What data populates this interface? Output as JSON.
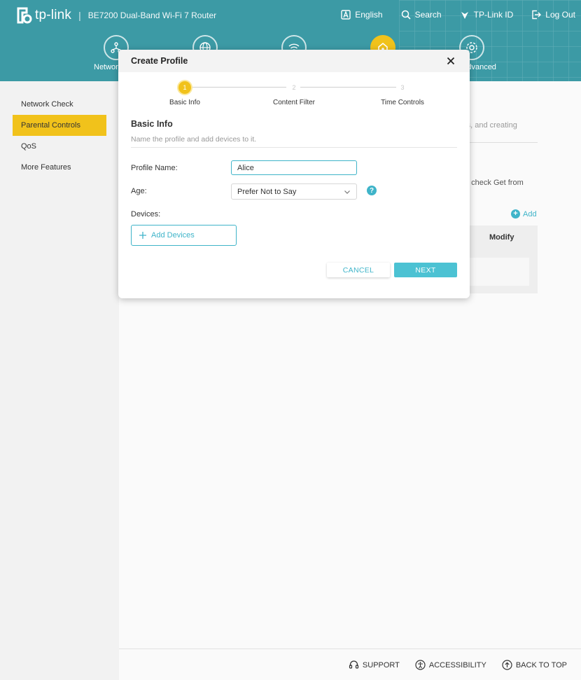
{
  "header": {
    "brand": "tp-link",
    "model": "BE7200 Dual-Band Wi-Fi 7 Router",
    "links": [
      {
        "label": "English",
        "icon": "language-icon"
      },
      {
        "label": "Search",
        "icon": "search-icon"
      },
      {
        "label": "TP-Link ID",
        "icon": "tplink-id-icon"
      },
      {
        "label": "Log Out",
        "icon": "logout-icon"
      }
    ],
    "nav": [
      {
        "label": "Network",
        "icon": "network-icon"
      },
      {
        "label": "",
        "icon": "internet-icon"
      },
      {
        "label": "",
        "icon": "wireless-icon"
      },
      {
        "label": "",
        "icon": "homeshield-icon",
        "active": true
      },
      {
        "label": "Advanced",
        "icon": "advanced-icon"
      }
    ]
  },
  "sidebar": {
    "items": [
      {
        "label": "Network Check"
      },
      {
        "label": "Parental Controls",
        "active": true
      },
      {
        "label": "QoS"
      },
      {
        "label": "More Features"
      }
    ]
  },
  "background": {
    "text1": "mits, and creating",
    "text2": "o check Get from",
    "add_label": "Add",
    "modify_header": "Modify"
  },
  "modal": {
    "title": "Create Profile",
    "steps": [
      {
        "num": "1",
        "label": "Basic Info",
        "active": true
      },
      {
        "num": "2",
        "label": "Content Filter"
      },
      {
        "num": "3",
        "label": "Time Controls"
      }
    ],
    "section_title": "Basic Info",
    "section_desc": "Name the profile and add devices to it.",
    "profile_name_label": "Profile Name:",
    "profile_name_value": "Alice",
    "age_label": "Age:",
    "age_value": "Prefer Not to Say",
    "devices_label": "Devices:",
    "add_devices_label": "Add Devices",
    "cancel_label": "CANCEL",
    "next_label": "NEXT"
  },
  "footer": {
    "support": "SUPPORT",
    "accessibility": "ACCESSIBILITY",
    "back_to_top": "BACK TO TOP"
  },
  "colors": {
    "header_bg": "#3c9aa5",
    "accent_yellow": "#f1c21b",
    "accent_teal": "#3fb4c9"
  }
}
